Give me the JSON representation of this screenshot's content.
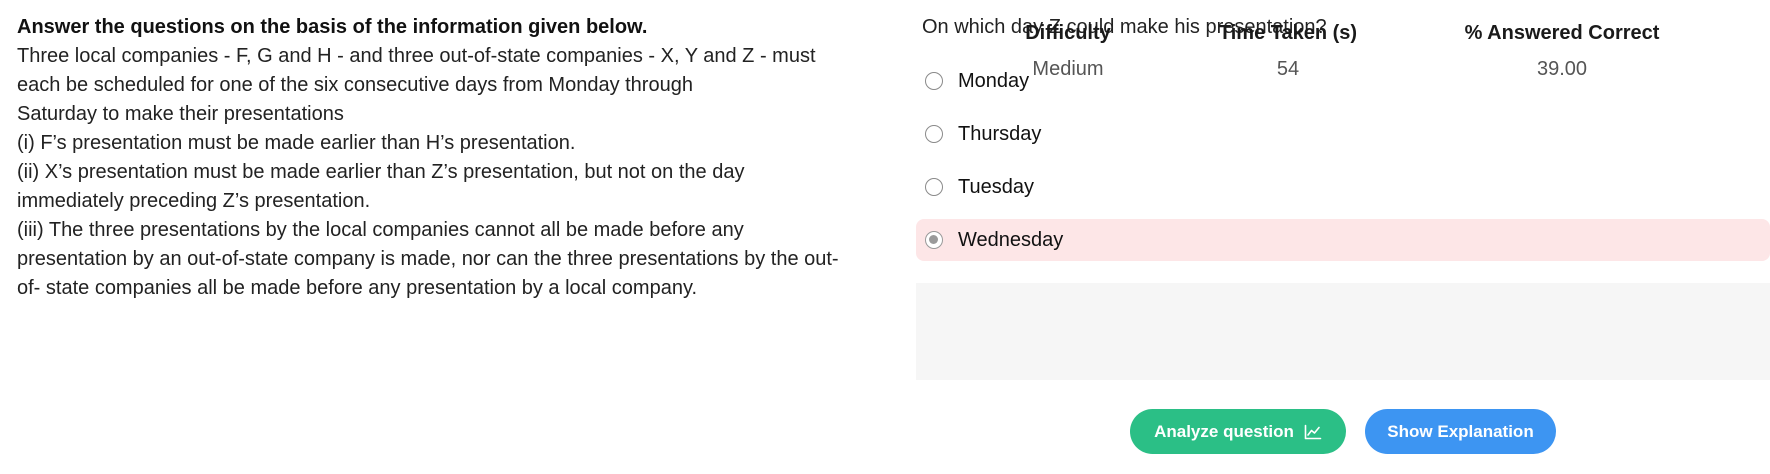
{
  "passage": {
    "heading": "Answer the questions on the basis of the information given below.",
    "lines": [
      "Three local companies - F, G and H - and three out-of-state companies - X, Y and Z - must",
      "each be scheduled for one of the six consecutive days from Monday through",
      "Saturday to make their presentations",
      "(i) F’s presentation must be made earlier than H’s presentation.",
      "(ii) X’s presentation must be made earlier than Z’s presentation, but not on the day",
      "immediately preceding Z’s presentation.",
      "(iii) The three presentations by the local companies cannot all be made before any",
      "presentation by an out-of-state company is made, nor can the three presentations by the out-",
      "of- state companies all be made before any presentation by a local company."
    ]
  },
  "question": {
    "text": "On which day Z could make his presentation?",
    "options": [
      {
        "label": "Monday",
        "selected": false
      },
      {
        "label": "Thursday",
        "selected": false
      },
      {
        "label": "Tuesday",
        "selected": false
      },
      {
        "label": "Wednesday",
        "selected": true
      }
    ]
  },
  "stats": {
    "difficulty_label": "Difficulty",
    "difficulty_value": "Medium",
    "time_label": "Time Taken (s)",
    "time_value": "54",
    "correct_label": "% Answered Correct",
    "correct_value": "39.00"
  },
  "buttons": {
    "analyze": "Analyze question",
    "analyze_icon": "line-chart-icon",
    "explain": "Show Explanation"
  },
  "colors": {
    "selected_bg": "#fde6e7",
    "analyze_bg": "#2bbf86",
    "explain_bg": "#3d95f2",
    "stats_bg": "#f6f6f6"
  }
}
